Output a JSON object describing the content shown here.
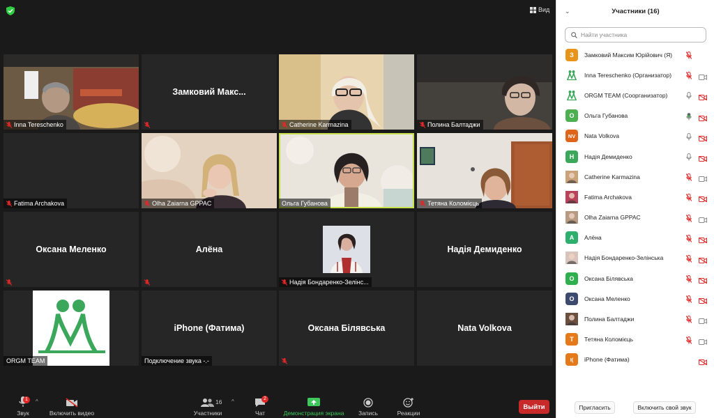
{
  "meeting": {
    "view_label": "Вид",
    "tiles": [
      {
        "name": "Inna Tereschenko",
        "center": "",
        "type": "video1",
        "muted": true
      },
      {
        "name": "",
        "center": "Замковий  Макс...",
        "type": "name",
        "muted": true
      },
      {
        "name": "Catherine Karmazina",
        "center": "",
        "type": "video3",
        "muted": true
      },
      {
        "name": "Полина Балтаджи",
        "center": "",
        "type": "video4",
        "muted": true
      },
      {
        "name": "Fatima Archakova",
        "center": "",
        "type": "dark",
        "muted": true
      },
      {
        "name": "Olha Zaiarna GPPAC",
        "center": "",
        "type": "video6",
        "muted": true
      },
      {
        "name": "Ольга Губанова",
        "center": "",
        "type": "video7",
        "muted": false
      },
      {
        "name": "Тетяна Коломієць",
        "center": "",
        "type": "video8",
        "muted": true
      },
      {
        "name": "",
        "center": "Оксана Меленко",
        "type": "name",
        "muted": true
      },
      {
        "name": "",
        "center": "Алёна",
        "type": "name",
        "muted": true
      },
      {
        "name": "Надія Бондаренко-Зелінс...",
        "center": "",
        "type": "photo",
        "muted": true
      },
      {
        "name": "",
        "center": "Надія Демиденко",
        "type": "name",
        "muted": false
      },
      {
        "name": "ORGM TEAM",
        "center": "",
        "type": "logo",
        "muted": false
      },
      {
        "name": "Подключение звука -.-",
        "center": "iPhone (Фатима)",
        "type": "name",
        "muted": false
      },
      {
        "name": "",
        "center": "Оксана Білявська",
        "type": "name",
        "muted": true
      },
      {
        "name": "",
        "center": "Nata Volkova",
        "type": "name",
        "muted": false
      }
    ]
  },
  "toolbar": {
    "audio": {
      "label": "Звук",
      "badge": "1"
    },
    "video": {
      "label": "Включить видео"
    },
    "participants": {
      "label": "Участники",
      "count": "16"
    },
    "chat": {
      "label": "Чат",
      "badge": "2"
    },
    "share": {
      "label": "Демонстрация экрана"
    },
    "record": {
      "label": "Запись"
    },
    "reactions": {
      "label": "Реакции"
    },
    "leave": {
      "label": "Выйти"
    }
  },
  "panel": {
    "title": "Участники (16)",
    "search_placeholder": "Найти участника",
    "participants": [
      {
        "name": "Замковий Максим Юрійович (Я)",
        "avatar": "З",
        "color": "#e8941a",
        "kind": "letter",
        "mic": "muted",
        "cam": "none"
      },
      {
        "name": "Inna Tereschenko (Организатор)",
        "avatar": "",
        "color": "#3aa75a",
        "kind": "logo",
        "mic": "muted",
        "cam": "on"
      },
      {
        "name": "ORGM TEAM (Соорганизатор)",
        "avatar": "",
        "color": "#3aa75a",
        "kind": "logo",
        "mic": "on",
        "cam": "off"
      },
      {
        "name": "Ольга Губанова",
        "avatar": "О",
        "color": "#4caf50",
        "kind": "letter",
        "mic": "active",
        "cam": "off"
      },
      {
        "name": "Nata Volkova",
        "avatar": "NV",
        "color": "#e0651b",
        "kind": "letter",
        "mic": "on",
        "cam": "off"
      },
      {
        "name": "Надія Демиденко",
        "avatar": "Н",
        "color": "#3aa75a",
        "kind": "letter",
        "mic": "on",
        "cam": "off"
      },
      {
        "name": "Catherine Karmazina",
        "avatar": "",
        "color": "#c9a27a",
        "kind": "photo",
        "mic": "muted",
        "cam": "on"
      },
      {
        "name": "Fatima Archakova",
        "avatar": "",
        "color": "#b8425a",
        "kind": "photo",
        "mic": "muted",
        "cam": "off"
      },
      {
        "name": "Olha Zaiarna GPPAC",
        "avatar": "",
        "color": "#b99a82",
        "kind": "photo",
        "mic": "muted",
        "cam": "on"
      },
      {
        "name": "Алёна",
        "avatar": "А",
        "color": "#2eaf6e",
        "kind": "letter",
        "mic": "muted",
        "cam": "off"
      },
      {
        "name": "Надія Бондаренко-Зелінська",
        "avatar": "",
        "color": "#d9c4bb",
        "kind": "photo",
        "mic": "muted",
        "cam": "off"
      },
      {
        "name": "Оксана Білявська",
        "avatar": "О",
        "color": "#2eaf4e",
        "kind": "letter",
        "mic": "muted",
        "cam": "off"
      },
      {
        "name": "Оксана Меленко",
        "avatar": "О",
        "color": "#3c4a6e",
        "kind": "letter",
        "mic": "muted",
        "cam": "off"
      },
      {
        "name": "Полина Балтаджи",
        "avatar": "",
        "color": "#6b5040",
        "kind": "photo",
        "mic": "muted",
        "cam": "on"
      },
      {
        "name": "Тетяна Коломієць",
        "avatar": "Т",
        "color": "#e57a1a",
        "kind": "letter",
        "mic": "muted",
        "cam": "on"
      },
      {
        "name": "iPhone (Фатима)",
        "avatar": "I(",
        "color": "#e57a1a",
        "kind": "letter",
        "mic": "none",
        "cam": "off"
      }
    ],
    "invite_label": "Пригласить",
    "unmute_label": "Включить свой звук"
  }
}
